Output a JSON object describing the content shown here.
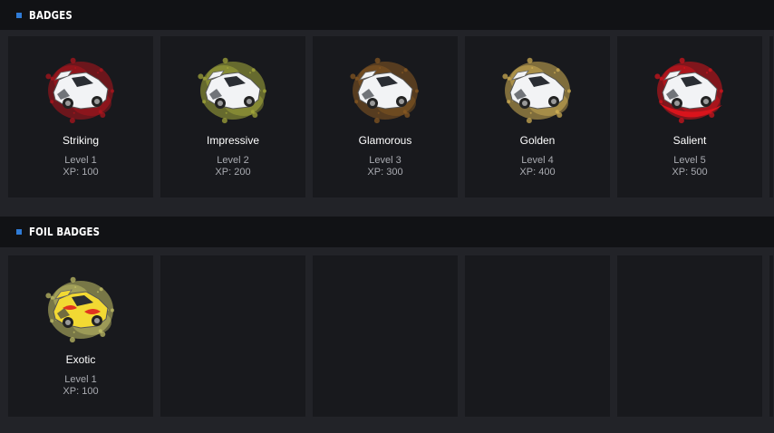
{
  "badges_section": {
    "title": "BADGES"
  },
  "badges": [
    {
      "name": "Striking",
      "level": "Level 1",
      "xp": "XP: 100",
      "splash_color": "#b3141c",
      "icon": "car-badge-striking-icon"
    },
    {
      "name": "Impressive",
      "level": "Level 2",
      "xp": "XP: 200",
      "splash_color": "#a8ad3c",
      "icon": "car-badge-impressive-icon"
    },
    {
      "name": "Glamorous",
      "level": "Level 3",
      "xp": "XP: 300",
      "splash_color": "#8a5a22",
      "icon": "car-badge-glamorous-icon"
    },
    {
      "name": "Golden",
      "level": "Level 4",
      "xp": "XP: 400",
      "splash_color": "#d6b356",
      "icon": "car-badge-golden-icon"
    },
    {
      "name": "Salient",
      "level": "Level 5",
      "xp": "XP: 500",
      "splash_color": "#d9141c",
      "icon": "car-badge-salient-icon"
    }
  ],
  "foil_section": {
    "title": "FOIL BADGES"
  },
  "foil_badges": [
    {
      "name": "Exotic",
      "level": "Level 1",
      "xp": "XP: 100",
      "splash_color": "#c8c56a",
      "car_color": "#f2d933",
      "icon": "car-badge-exotic-icon"
    }
  ],
  "colors": {
    "accent": "#2f7bd6",
    "card_bg": "#18191d",
    "header_bg": "#111215",
    "page_bg": "#222328"
  }
}
